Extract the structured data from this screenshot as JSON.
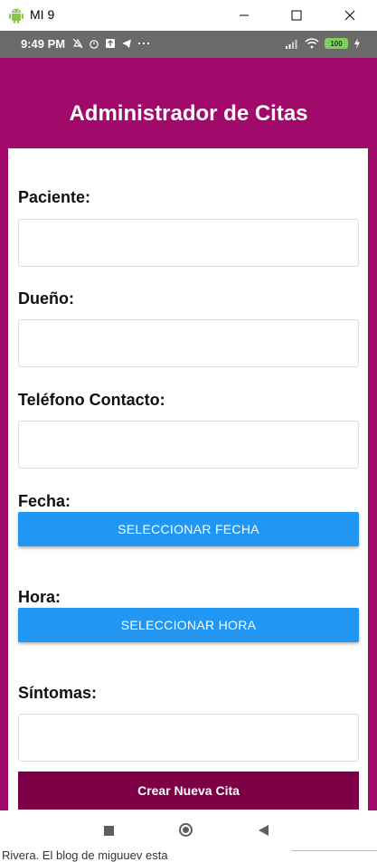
{
  "window": {
    "title": "MI 9",
    "app_icon": "android-icon",
    "controls": [
      "minimize-icon",
      "maximize-icon",
      "close-icon"
    ]
  },
  "status_bar": {
    "time": "9:49 PM",
    "battery": "100",
    "icons": [
      "mute-icon",
      "alarm-icon",
      "notification-icon",
      "telegram-icon",
      "more-icon",
      "signal-icon",
      "wifi-icon",
      "battery-icon",
      "charging-icon"
    ]
  },
  "app": {
    "title": "Administrador de Citas",
    "colors": {
      "primary": "#a10a6b",
      "button": "#2196f3",
      "submit": "#7d0047"
    }
  },
  "form": {
    "paciente_label": "Paciente:",
    "paciente_value": "",
    "dueno_label": "Dueño:",
    "dueno_value": "",
    "telefono_label": "Teléfono Contacto:",
    "telefono_value": "",
    "fecha_label": "Fecha:",
    "fecha_button": "SELECCIONAR FECHA",
    "hora_label": "Hora:",
    "hora_button": "SELECCIONAR HORA",
    "sintomas_label": "Síntomas:",
    "sintomas_value": "",
    "submit_label": "Crear Nueva Cita"
  },
  "nav_bar": {
    "icons": [
      "recent-apps-icon",
      "home-icon",
      "back-icon"
    ]
  },
  "footer_text": "Rivera. El blog de miguuev esta"
}
